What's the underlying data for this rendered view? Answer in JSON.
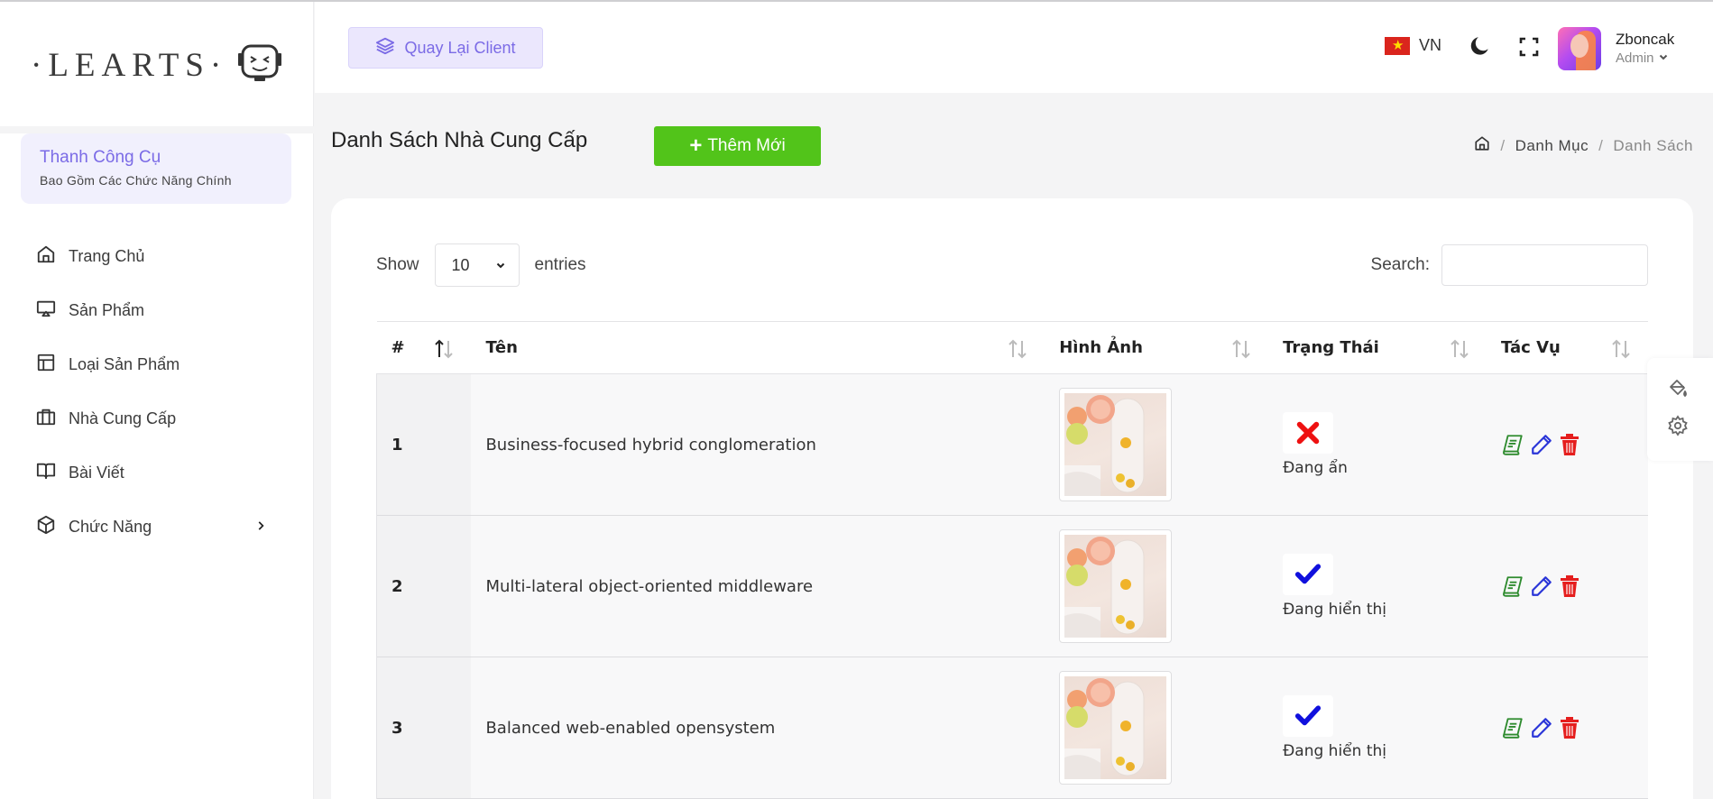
{
  "brand": {
    "logo_text": "·LEARTS·"
  },
  "sidebar": {
    "toolbox_title": "Thanh Công Cụ",
    "toolbox_subtitle": "Bao Gồm Các Chức Năng Chính",
    "items": [
      {
        "label": "Trang Chủ",
        "icon": "home-icon"
      },
      {
        "label": "Sản Phẩm",
        "icon": "monitor-icon"
      },
      {
        "label": "Loại Sản Phẩm",
        "icon": "layout-icon"
      },
      {
        "label": "Nhà Cung Cấp",
        "icon": "briefcase-icon"
      },
      {
        "label": "Bài Viết",
        "icon": "book-icon"
      },
      {
        "label": "Chức Năng",
        "icon": "box-icon"
      }
    ]
  },
  "header": {
    "client_button": "Quay Lại Client",
    "language": "VN",
    "user_name": "Zboncak",
    "user_role": "Admin"
  },
  "page": {
    "title": "Danh Sách Nhà Cung Cấp",
    "add_button": "Thêm Mới",
    "breadcrumb": [
      "Danh Mục",
      "Danh Sách"
    ]
  },
  "table_controls": {
    "show_label": "Show",
    "entries_value": "10",
    "entries_label": "entries",
    "search_label": "Search:"
  },
  "table": {
    "columns": [
      "#",
      "Tên",
      "Hình Ảnh",
      "Trạng Thái",
      "Tác Vụ"
    ],
    "rows": [
      {
        "num": "1",
        "name": "Business-focused hybrid conglomeration",
        "status": "Đang ẩn",
        "status_icon": "x-icon"
      },
      {
        "num": "2",
        "name": "Multi-lateral object-oriented middleware",
        "status": "Đang hiển thị",
        "status_icon": "check-icon"
      },
      {
        "num": "3",
        "name": "Balanced web-enabled opensystem",
        "status": "Đang hiển thị",
        "status_icon": "check-icon"
      }
    ]
  },
  "colors": {
    "accent": "#7b6be6",
    "add_button": "#52c41a",
    "hidden_status": "#ee1111",
    "visible_status": "#1010dd",
    "view_action": "#2e8b2e",
    "edit_action": "#2a35d8",
    "delete_action": "#e51e1e"
  }
}
